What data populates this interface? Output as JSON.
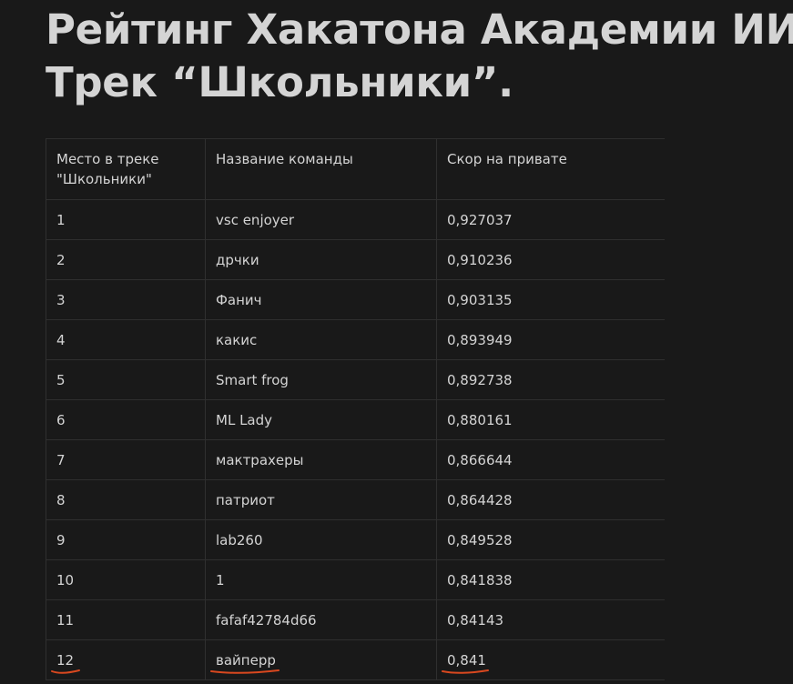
{
  "page": {
    "title_line1": "Рейтинг Хакатона Академии ИИ.",
    "title_line2": "Трек “Школьники”."
  },
  "table": {
    "headers": [
      "Место в треке\n\"Школьники\"",
      "Название команды",
      "Скор на привате"
    ],
    "rows": [
      {
        "place": "1",
        "team": "vsc enjoyer",
        "score": "0,927037"
      },
      {
        "place": "2",
        "team": "дрчки",
        "score": "0,910236"
      },
      {
        "place": "3",
        "team": "Фанич",
        "score": "0,903135"
      },
      {
        "place": "4",
        "team": "какис",
        "score": "0,893949"
      },
      {
        "place": "5",
        "team": "Smart frog",
        "score": "0,892738"
      },
      {
        "place": "6",
        "team": "ML Lady",
        "score": "0,880161"
      },
      {
        "place": "7",
        "team": "мактрахеры",
        "score": "0,866644"
      },
      {
        "place": "8",
        "team": "патриот",
        "score": "0,864428"
      },
      {
        "place": "9",
        "team": "lab260",
        "score": "0,849528"
      },
      {
        "place": "10",
        "team": "1",
        "score": "0,841838"
      },
      {
        "place": "11",
        "team": "fafaf42784d66",
        "score": "0,84143"
      },
      {
        "place": "12",
        "team": "вайперр",
        "score": "0,841"
      }
    ],
    "highlighted_row_place": "12"
  },
  "colors": {
    "background": "#191919",
    "text": "#d4d4d4",
    "border": "#2f2f2f",
    "underline": "#d9481f"
  }
}
